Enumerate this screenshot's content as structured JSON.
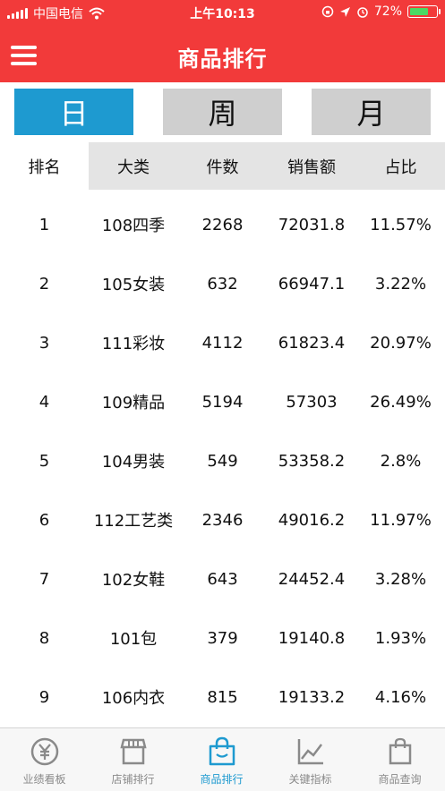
{
  "status_bar": {
    "carrier": "中国电信",
    "time": "上午10:13",
    "battery": "72%",
    "battery_level": 0.72
  },
  "header": {
    "title": "商品排行",
    "menu_icon": "hamburger-menu-icon"
  },
  "period_tabs": [
    {
      "label": "日",
      "active": true
    },
    {
      "label": "周",
      "active": false
    },
    {
      "label": "月",
      "active": false
    }
  ],
  "table": {
    "columns": [
      "排名",
      "大类",
      "件数",
      "销售额",
      "占比"
    ],
    "rows": [
      {
        "rank": "1",
        "category": "108四季",
        "count": "2268",
        "sales": "72031.8",
        "share": "11.57%"
      },
      {
        "rank": "2",
        "category": "105女装",
        "count": "632",
        "sales": "66947.1",
        "share": "3.22%"
      },
      {
        "rank": "3",
        "category": "111彩妆",
        "count": "4112",
        "sales": "61823.4",
        "share": "20.97%"
      },
      {
        "rank": "4",
        "category": "109精品",
        "count": "5194",
        "sales": "57303",
        "share": "26.49%"
      },
      {
        "rank": "5",
        "category": "104男装",
        "count": "549",
        "sales": "53358.2",
        "share": "2.8%"
      },
      {
        "rank": "6",
        "category": "112工艺类",
        "count": "2346",
        "sales": "49016.2",
        "share": "11.97%"
      },
      {
        "rank": "7",
        "category": "102女鞋",
        "count": "643",
        "sales": "24452.4",
        "share": "3.28%"
      },
      {
        "rank": "8",
        "category": "101包",
        "count": "379",
        "sales": "19140.8",
        "share": "1.93%"
      },
      {
        "rank": "9",
        "category": "106内衣",
        "count": "815",
        "sales": "19133.2",
        "share": "4.16%"
      }
    ]
  },
  "tab_bar": [
    {
      "label": "业绩看板",
      "icon": "yuan-coin-icon",
      "active": false
    },
    {
      "label": "店铺排行",
      "icon": "storefront-icon",
      "active": false
    },
    {
      "label": "商品排行",
      "icon": "shopping-bag-icon",
      "active": true
    },
    {
      "label": "关键指标",
      "icon": "line-chart-icon",
      "active": false
    },
    {
      "label": "商品查询",
      "icon": "bag-search-icon",
      "active": false
    }
  ],
  "colors": {
    "brand_red": "#f23a3a",
    "accent_blue": "#1e9ad0",
    "tab_inactive": "#cfcfcf",
    "header_gray": "#e4e4e4"
  }
}
